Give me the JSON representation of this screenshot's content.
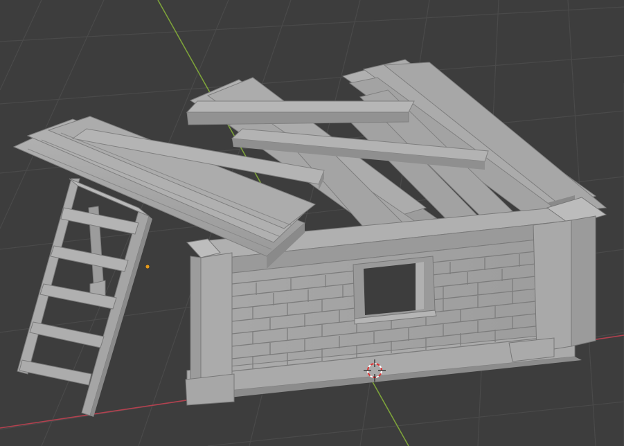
{
  "app": {
    "name": ""
  },
  "viewport": {
    "mode": "perspective",
    "background_color": "#3d3d3d",
    "grid_color": "#4a4a4a",
    "x_axis_color": "#b3414f",
    "y_axis_color": "#7da23a",
    "model_color": "#a0a0a0"
  },
  "scene": {
    "objects": [
      {
        "name_label": "ladder",
        "icon": "ladder-icon"
      },
      {
        "name_label": "brick-wall",
        "icon": "wall-icon"
      },
      {
        "name_label": "roof-planks",
        "icon": "plank-icon"
      }
    ],
    "origin_dot_color": "#e69a1a",
    "cursor_3d": {
      "icon": "crosshair-icon",
      "color": "#d33"
    }
  }
}
